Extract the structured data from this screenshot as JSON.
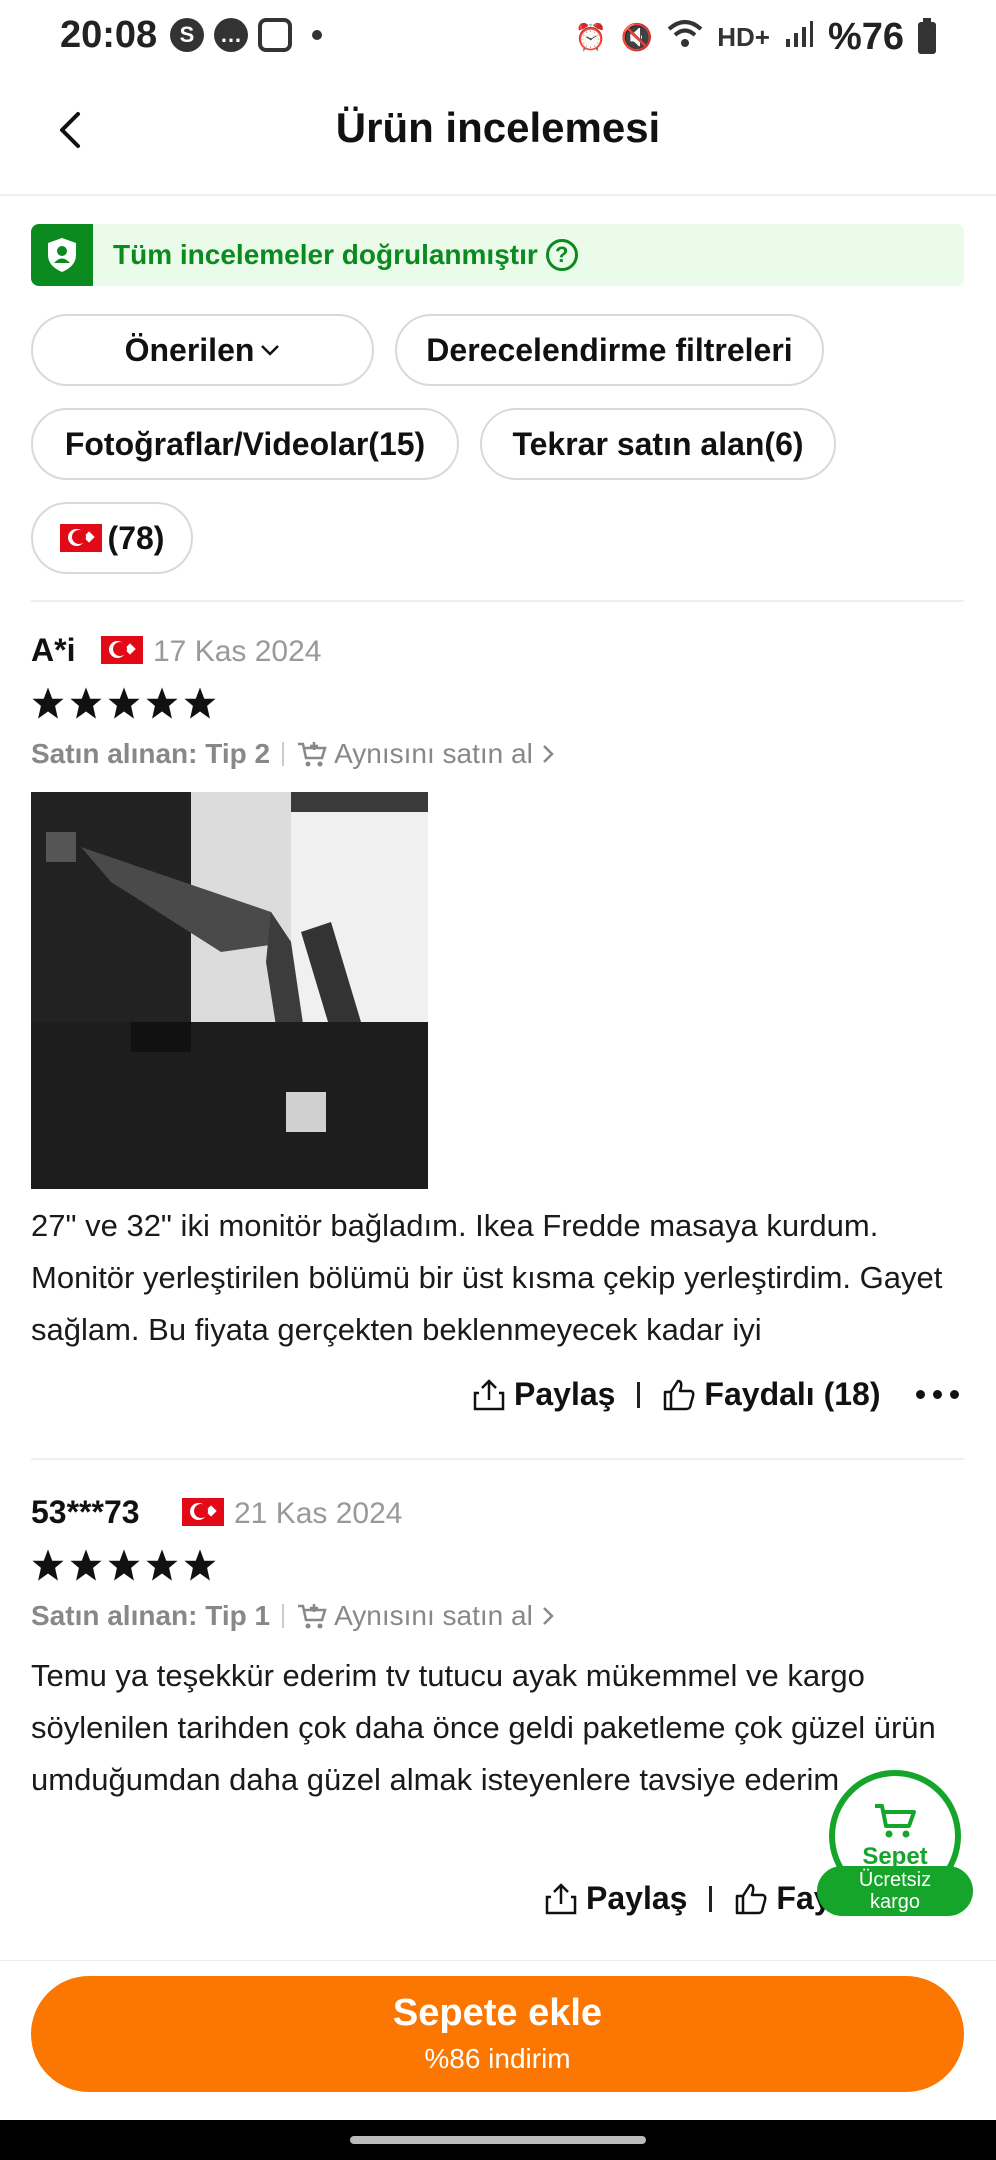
{
  "status_bar": {
    "time": "20:08",
    "battery": "%76",
    "network": "HD+"
  },
  "header": {
    "title": "Ürün incelemesi"
  },
  "verified_banner": {
    "text": "Tüm incelemeler doğrulanmıştır"
  },
  "filters": {
    "sort": "Önerilen",
    "rating": "Derecelendirme filtreleri",
    "photos": "Fotoğraflar/Videolar(15)",
    "repurchased": "Tekrar satın alan(6)",
    "country_count": "(78)"
  },
  "reviews": [
    {
      "name": "A*i",
      "date": "17 Kas 2024",
      "stars": 5,
      "purchased_label": "Satın alınan: Tip 2",
      "buy_same": "Aynısını satın al",
      "text": "27\" ve 32\" iki monitör bağladım. Ikea Fredde masaya kurdum. Monitör yerleştirilen bölümü bir üst kısma çekip yerleştirdim. Gayet sağlam. Bu fiyata gerçekten beklenmeyecek kadar iyi",
      "share": "Paylaş",
      "helpful": "Faydalı (18)"
    },
    {
      "name": "53***73",
      "date": "21 Kas 2024",
      "stars": 5,
      "purchased_label": "Satın alınan: Tip 1",
      "buy_same": "Aynısını satın al",
      "text": "Temu ya teşekkür ederim tv tutucu ayak mükemmel ve kargo söylenilen tarihden çok daha önce geldi paketleme çok güzel ürün umduğumdan daha güzel almak isteyenlere tavsiye ederim",
      "share": "Paylaş",
      "helpful": "Faydalı"
    }
  ],
  "floating_cart": {
    "label": "Sepet",
    "badge_line1": "Ücretsiz",
    "badge_line2": "kargo"
  },
  "bottom": {
    "add_to_cart": "Sepete ekle",
    "discount": "%86 indirim",
    "accent_color": "#fb7701"
  }
}
